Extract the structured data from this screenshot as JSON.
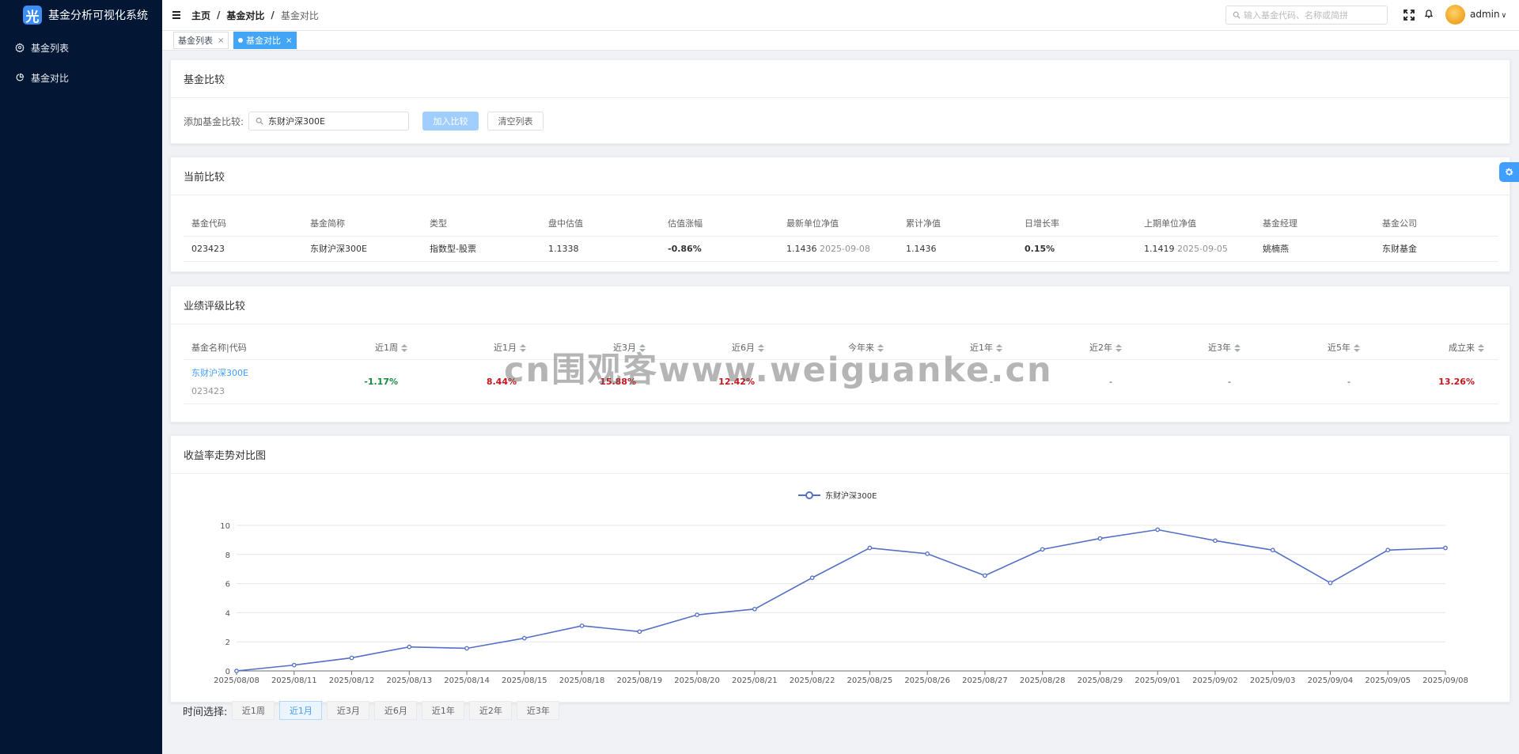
{
  "app": {
    "logo_char": "光",
    "title": "基金分析可视化系统"
  },
  "sidebar": {
    "items": [
      {
        "label": "基金列表",
        "icon": "gear-icon"
      },
      {
        "label": "基金对比",
        "icon": "pie-chart-icon"
      }
    ]
  },
  "header": {
    "breadcrumb": [
      "主页",
      "基金对比",
      "基金对比"
    ],
    "search_placeholder": "输入基金代码、名称或简拼",
    "user": "admin"
  },
  "tabs": [
    {
      "label": "基金列表",
      "active": false
    },
    {
      "label": "基金对比",
      "active": true
    }
  ],
  "compare": {
    "title": "基金比较",
    "add_label": "添加基金比较:",
    "input_value": "东财沪深300E",
    "add_button": "加入比较",
    "clear_button": "清空列表"
  },
  "current": {
    "title": "当前比较",
    "headers": [
      "基金代码",
      "基金简称",
      "类型",
      "盘中估值",
      "估值涨幅",
      "最新单位净值",
      "累计净值",
      "日增长率",
      "上期单位净值",
      "基金经理",
      "基金公司"
    ],
    "row": {
      "code": "023423",
      "name": "东财沪深300E",
      "type": "指数型-股票",
      "estimate": "1.1338",
      "estimate_change": "-0.86%",
      "latest_nav": "1.1436",
      "latest_nav_date": "2025-09-08",
      "acc_nav": "1.1436",
      "daily_growth": "0.15%",
      "prev_nav": "1.1419",
      "prev_nav_date": "2025-09-05",
      "manager": "姚楠燕",
      "company": "东财基金"
    }
  },
  "performance": {
    "title": "业绩评级比较",
    "headers": [
      "基金名称|代码",
      "近1周",
      "近1月",
      "近3月",
      "近6月",
      "今年来",
      "近1年",
      "近2年",
      "近3年",
      "近5年",
      "成立来"
    ],
    "row": {
      "name": "东财沪深300E",
      "code": "023423",
      "values": [
        "-1.17%",
        "8.44%",
        "15.88%",
        "12.42%",
        "-",
        "-",
        "-",
        "-",
        "-",
        "13.26%"
      ]
    }
  },
  "trend": {
    "title": "收益率走势对比图"
  },
  "chart_data": {
    "type": "line",
    "title": "",
    "x": [
      "2025/08/08",
      "2025/08/11",
      "2025/08/12",
      "2025/08/13",
      "2025/08/14",
      "2025/08/15",
      "2025/08/18",
      "2025/08/19",
      "2025/08/20",
      "2025/08/21",
      "2025/08/22",
      "2025/08/25",
      "2025/08/26",
      "2025/08/27",
      "2025/08/28",
      "2025/08/29",
      "2025/09/01",
      "2025/09/02",
      "2025/09/03",
      "2025/09/04",
      "2025/09/05",
      "2025/09/08"
    ],
    "series": [
      {
        "name": "东财沪深300E",
        "color": "#5470c6",
        "values": [
          0,
          0.4,
          0.9,
          1.65,
          1.55,
          2.25,
          3.1,
          2.7,
          3.85,
          4.25,
          6.4,
          8.45,
          8.05,
          6.55,
          8.35,
          9.1,
          9.7,
          8.95,
          8.3,
          6.05,
          8.3,
          8.45
        ]
      }
    ],
    "ylim": [
      0,
      10
    ],
    "yticks": [
      0,
      2,
      4,
      6,
      8,
      10
    ],
    "legend": "top-center",
    "grid": true
  },
  "time_select": {
    "label": "时间选择:",
    "options": [
      "近1周",
      "近1月",
      "近3月",
      "近6月",
      "近1年",
      "近2年",
      "近3年"
    ],
    "active_index": 1
  },
  "watermark": "cn围观客www.weiguanke.cn"
}
